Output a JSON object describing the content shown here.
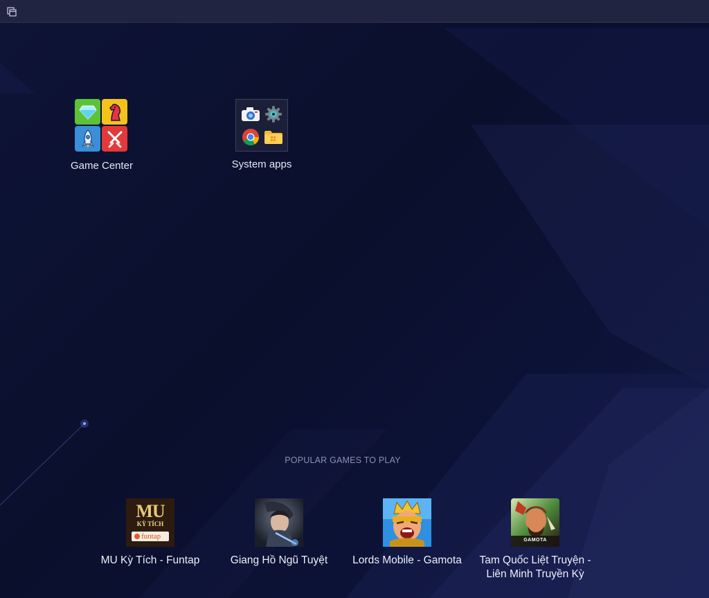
{
  "topbar": {
    "menu_icon": "multi-window-icon"
  },
  "desktop": {
    "icons": [
      {
        "label": "Game Center",
        "icon": "game-center-folder-icon"
      },
      {
        "label": "System apps",
        "icon": "system-apps-folder-icon"
      }
    ]
  },
  "popular": {
    "heading": "POPULAR GAMES TO PLAY",
    "games": [
      {
        "label": "MU Kỳ Tích - Funtap",
        "art_logo": "MU",
        "art_sub": "KỲ TÍCH",
        "art_brand": "funtap"
      },
      {
        "label": "Giang Hồ Ngũ Tuyệt"
      },
      {
        "label": "Lords Mobile - Gamota"
      },
      {
        "label": "Tam Quốc Liệt Truyện - Liên Minh Truyền Kỳ",
        "art_brand": "GAMOTA"
      }
    ]
  },
  "colors": {
    "background": "#0b1030",
    "topbar": "#212440",
    "label": "#e6e8f2",
    "heading": "#8a90b0"
  }
}
